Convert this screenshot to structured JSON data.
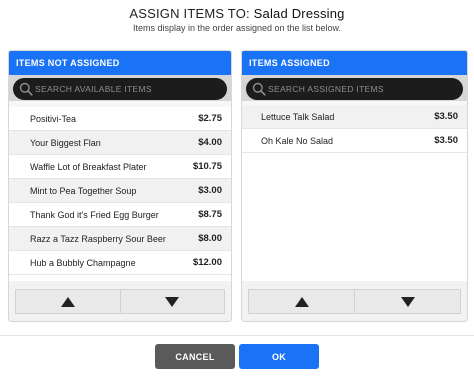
{
  "header": {
    "title_prefix": "ASSIGN ITEMS TO:",
    "title_target": "Salad Dressing",
    "subtitle": "Items display in the order assigned on the list below."
  },
  "left_panel": {
    "title": "ITEMS NOT ASSIGNED",
    "search_placeholder": "SEARCH AVAILABLE ITEMS",
    "items": [
      {
        "name": "Positivi-Tea",
        "price": "$2.75"
      },
      {
        "name": "Your Biggest Flan",
        "price": "$4.00"
      },
      {
        "name": "Waffle Lot of Breakfast Plater",
        "price": "$10.75"
      },
      {
        "name": "Mint to Pea Together Soup",
        "price": "$3.00"
      },
      {
        "name": "Thank God it's Fried Egg Burger",
        "price": "$8.75"
      },
      {
        "name": "Razz a Tazz Raspberry Sour Beer",
        "price": "$8.00"
      },
      {
        "name": "Hub a Bubbly Champagne",
        "price": "$12.00"
      }
    ]
  },
  "right_panel": {
    "title": "ITEMS ASSIGNED",
    "search_placeholder": "SEARCH ASSIGNED ITEMS",
    "items": [
      {
        "name": "Lettuce Talk Salad",
        "price": "$3.50"
      },
      {
        "name": "Oh Kale No Salad",
        "price": "$3.50"
      }
    ]
  },
  "footer": {
    "cancel_label": "CANCEL",
    "ok_label": "OK"
  },
  "colors": {
    "accent": "#1a73f5",
    "cancel": "#5a5a5a",
    "search_bg": "#1c1c1c"
  },
  "icons": [
    "search-icon",
    "arrow-up-icon",
    "arrow-down-icon"
  ]
}
